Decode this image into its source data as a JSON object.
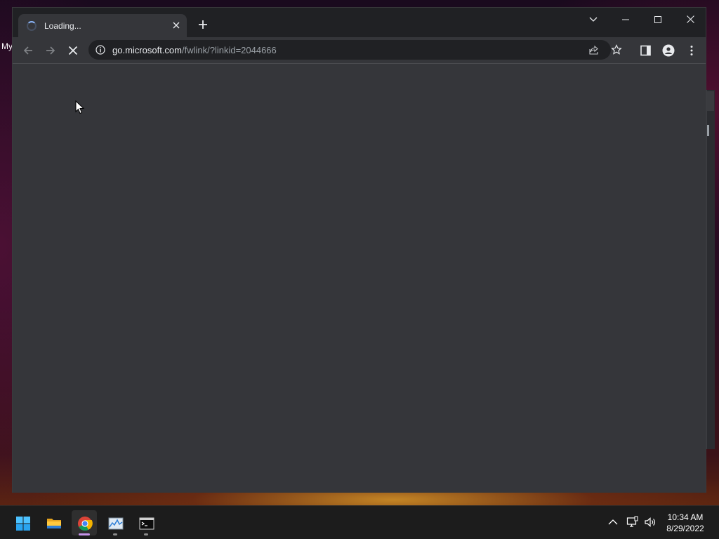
{
  "desktop": {
    "label_fragment": "My"
  },
  "browser": {
    "tab": {
      "title": "Loading...",
      "state": "loading"
    },
    "omnibox": {
      "url_host": "go.microsoft.com",
      "url_path": "/fwlink/?linkid=2044666"
    },
    "icons": {
      "back": "arrow-left-icon",
      "forward": "arrow-right-icon",
      "stop": "close-icon",
      "info": "info-icon",
      "share": "share-icon",
      "bookmark": "star-icon",
      "side_panel": "side-panel-icon",
      "profile": "person-icon",
      "menu": "kebab-menu-icon",
      "tab_search": "chevron-down-icon",
      "minimize": "minimize-icon",
      "maximize": "maximize-icon",
      "close": "close-icon"
    }
  },
  "taskbar": {
    "apps": [
      {
        "name": "Start",
        "icon": "windows-logo-icon"
      },
      {
        "name": "File Explorer",
        "icon": "folder-icon"
      },
      {
        "name": "Google Chrome",
        "icon": "chrome-icon",
        "active": true
      },
      {
        "name": "Performance Monitor",
        "icon": "chart-icon"
      },
      {
        "name": "Command Prompt",
        "icon": "terminal-icon"
      }
    ],
    "tray": {
      "icons": [
        "chevron-up-icon",
        "network-icon",
        "volume-icon"
      ]
    },
    "clock": {
      "time": "10:34 AM",
      "date": "8/29/2022"
    }
  },
  "colors": {
    "chrome_frame": "#202124",
    "chrome_toolbar": "#35363a",
    "accent_blue": "#8ab4f8",
    "windows_blue": "#4cc2ff"
  }
}
